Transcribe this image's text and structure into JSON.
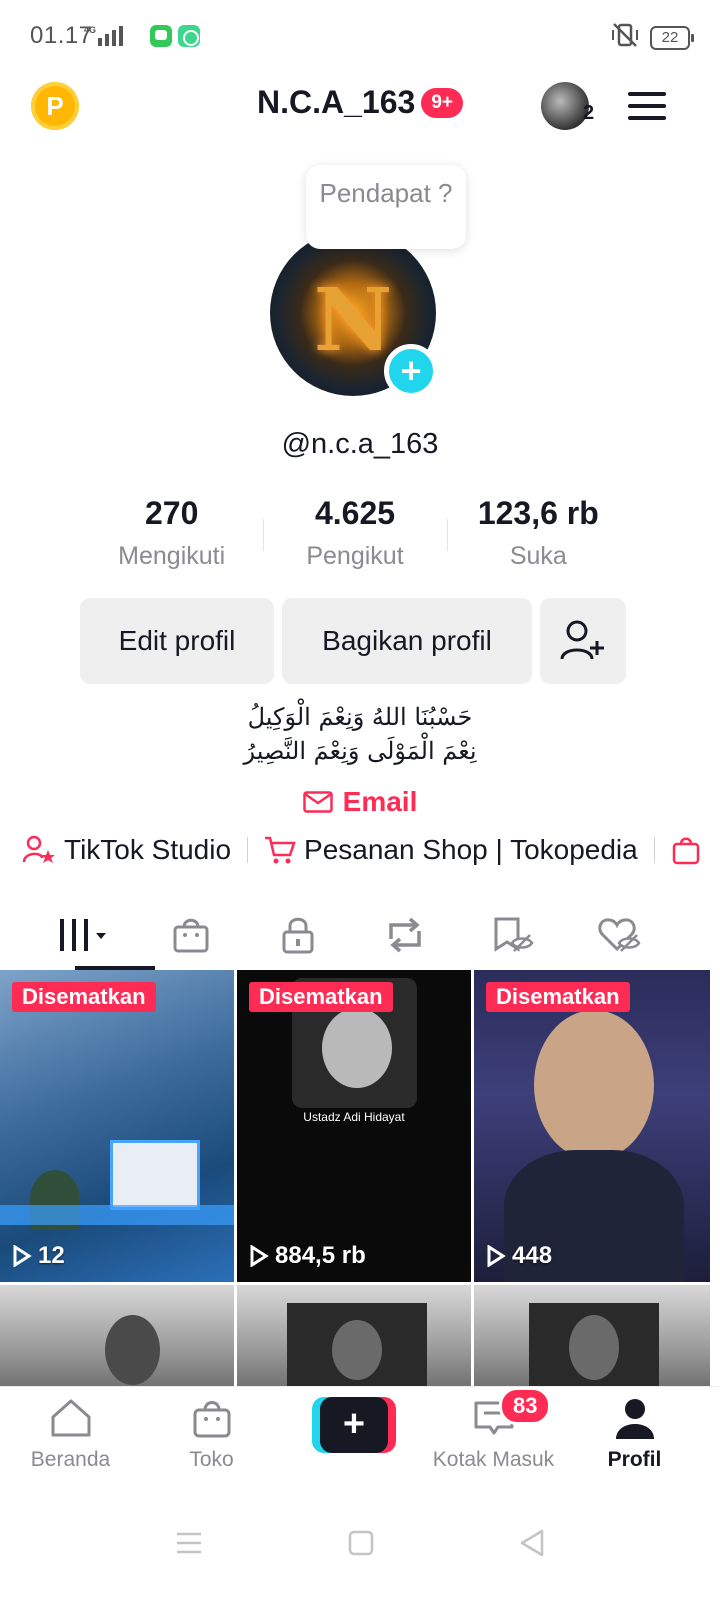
{
  "status_bar": {
    "time": "01.17",
    "network": "4G",
    "battery": "22"
  },
  "header": {
    "title": "N.C.A_163",
    "notification_badge": "9+",
    "account_count": "2",
    "coin_letter": "P"
  },
  "profile": {
    "bubble_text": "Pendapat ?",
    "username": "@n.c.a_163",
    "stats": [
      {
        "value": "270",
        "label": "Mengikuti"
      },
      {
        "value": "4.625",
        "label": "Pengikut"
      },
      {
        "value": "123,6 rb",
        "label": "Suka"
      }
    ],
    "edit_label": "Edit profil",
    "share_label": "Bagikan profil",
    "bio_line1": "حَسْبُنَا اللهُ وَنِعْمَ الْوَكِيلُ",
    "bio_line2": "نِعْمَ الْمَوْلَى وَنِعْمَ النَّصِيرُ",
    "email_label": "Email"
  },
  "links": [
    {
      "label": "TikTok Studio"
    },
    {
      "label": "Pesanan Shop | Tokopedia"
    }
  ],
  "tabs": [
    "videos-icon",
    "shop-icon",
    "private-icon",
    "repost-icon",
    "favorites-icon",
    "liked-icon"
  ],
  "videos": [
    {
      "pinned": "Disematkan",
      "views": "12"
    },
    {
      "pinned": "Disematkan",
      "views": "884,5 rb",
      "caption": "Ustadz Adi Hidayat"
    },
    {
      "pinned": "Disematkan",
      "views": "448"
    },
    {
      "pinned": "",
      "views": ""
    },
    {
      "pinned": "",
      "views": ""
    },
    {
      "pinned": "",
      "views": ""
    }
  ],
  "bottom_nav": {
    "home": "Beranda",
    "shop": "Toko",
    "inbox": "Kotak Masuk",
    "inbox_badge": "83",
    "profile": "Profil"
  },
  "colors": {
    "accent": "#fe2c55",
    "cyan": "#20d5ec",
    "text": "#161823",
    "muted": "#8a8b91"
  }
}
